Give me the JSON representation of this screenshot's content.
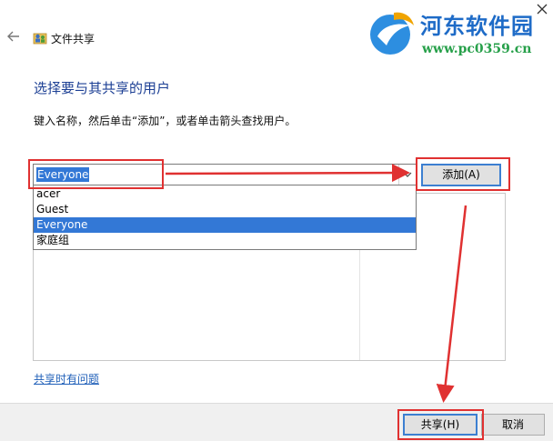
{
  "window": {
    "title": "文件共享",
    "heading": "选择要与其共享的用户",
    "instruction": "键入名称，然后单击“添加”，或者单击箭头查找用户。"
  },
  "watermark": {
    "name": "河东软件园",
    "url": "www.pc0359.cn"
  },
  "combo": {
    "value": "Everyone"
  },
  "dropdown": {
    "options": [
      "acer",
      "Guest",
      "Everyone",
      "家庭组"
    ],
    "selected": "Everyone"
  },
  "buttons": {
    "add": "添加(A)",
    "share": "共享(H)",
    "cancel": "取消"
  },
  "help_link": "共享时有问题",
  "colors": {
    "annotation": "#e03131",
    "selection": "#3378d6",
    "heading": "#1c3f94",
    "link": "#1f5fb8"
  }
}
